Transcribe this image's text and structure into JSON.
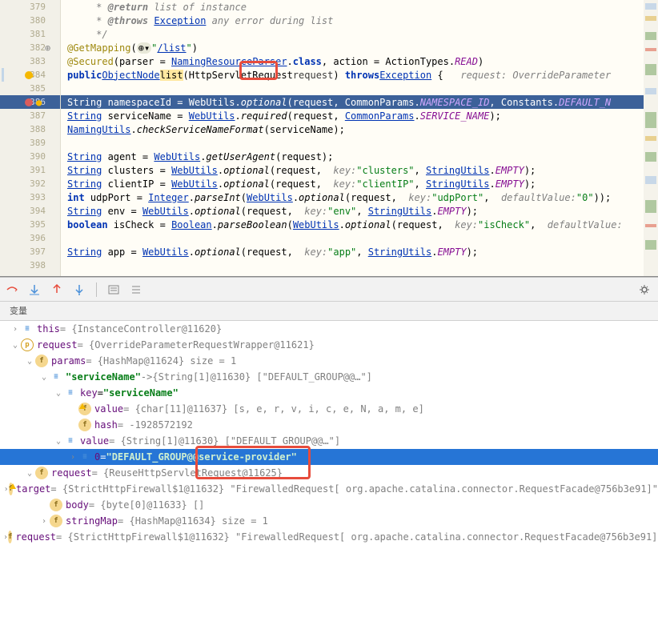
{
  "editor": {
    "lines": [
      {
        "num": 379,
        "kind": "doc",
        "content": "     * @return list of instance"
      },
      {
        "num": 380,
        "kind": "doc",
        "content": "     * @throws Exception any error during list"
      },
      {
        "num": 381,
        "kind": "doc",
        "content": "     */"
      },
      {
        "num": 382,
        "kind": "code",
        "content": "    @GetMapping(\"/list\")",
        "annotation": true,
        "gutter": "impl"
      },
      {
        "num": 383,
        "kind": "code",
        "content": "    @Secured(parser = NamingResourceParser.class, action = ActionTypes.READ)"
      },
      {
        "num": 384,
        "kind": "code",
        "content": "    public ObjectNode list(HttpServletRequest request) throws Exception {   request: OverrideParameter",
        "gutter": "breakpoint-warn"
      },
      {
        "num": 385,
        "kind": "blank",
        "content": ""
      },
      {
        "num": 386,
        "kind": "hl",
        "content": "        String namespaceId = WebUtils.optional(request, CommonParams.NAMESPACE_ID, Constants.DEFAULT_N",
        "gutter": "breakpoint"
      },
      {
        "num": 387,
        "kind": "code",
        "content": "        String serviceName = WebUtils.required(request, CommonParams.SERVICE_NAME);"
      },
      {
        "num": 388,
        "kind": "code",
        "content": "        NamingUtils.checkServiceNameFormat(serviceName);"
      },
      {
        "num": 389,
        "kind": "blank",
        "content": ""
      },
      {
        "num": 390,
        "kind": "code",
        "content": "        String agent = WebUtils.getUserAgent(request);"
      },
      {
        "num": 391,
        "kind": "code",
        "content": "        String clusters = WebUtils.optional(request,  key: \"clusters\", StringUtils.EMPTY);"
      },
      {
        "num": 392,
        "kind": "code",
        "content": "        String clientIP = WebUtils.optional(request,  key: \"clientIP\", StringUtils.EMPTY);"
      },
      {
        "num": 393,
        "kind": "code",
        "content": "        int udpPort = Integer.parseInt(WebUtils.optional(request,  key: \"udpPort\",  defaultValue: \"0\"));"
      },
      {
        "num": 394,
        "kind": "code",
        "content": "        String env = WebUtils.optional(request,  key: \"env\", StringUtils.EMPTY);"
      },
      {
        "num": 395,
        "kind": "code",
        "content": "        boolean isCheck = Boolean.parseBoolean(WebUtils.optional(request,  key: \"isCheck\",  defaultValue:"
      },
      {
        "num": 396,
        "kind": "blank",
        "content": ""
      },
      {
        "num": 397,
        "kind": "code",
        "content": "        String app = WebUtils.optional(request,  key: \"app\", StringUtils.EMPTY);"
      },
      {
        "num": 398,
        "kind": "blank",
        "content": ""
      }
    ],
    "highlighted_method": "list",
    "annotation_list_url": "/list"
  },
  "toolbar": {
    "tab_label": "变量"
  },
  "vars": {
    "rows": [
      {
        "depth": 0,
        "twisty": ">",
        "icon": "bars",
        "name": "this",
        "val": " = {InstanceController@11620}"
      },
      {
        "depth": 0,
        "twisty": "v",
        "icon": "p",
        "name": "request",
        "val": " = {OverrideParameterRequestWrapper@11621}"
      },
      {
        "depth": 1,
        "twisty": "v",
        "icon": "f",
        "name": "params",
        "val": " = {HashMap@11624}  size = 1"
      },
      {
        "depth": 2,
        "twisty": "v",
        "icon": "bars",
        "name": "\"serviceName\"",
        "nameStr": true,
        "arrow": " -> ",
        "val2": "{String[1]@11630} [\"DEFAULT_GROUP@@…\"]"
      },
      {
        "depth": 3,
        "twisty": "v",
        "icon": "bars",
        "name": "key",
        "eq": " = ",
        "valStr": "\"serviceName\""
      },
      {
        "depth": 4,
        "twisty": "",
        "icon": "f-warn",
        "name": "value",
        "val": " = {char[11]@11637} [s, e, r, v, i, c, e, N, a, m, e]"
      },
      {
        "depth": 4,
        "twisty": "",
        "icon": "f",
        "name": "hash",
        "val": " = -1928572192"
      },
      {
        "depth": 3,
        "twisty": "v",
        "icon": "bars",
        "name": "value",
        "val": " = {String[1]@11630} [\"DEFAULT_GROUP@@…\"]"
      },
      {
        "depth": 4,
        "twisty": ">",
        "icon": "arr",
        "name": "0",
        "eq": " = ",
        "valStr": "\"DEFAULT_GROUP@@service-provider\"",
        "selected": true
      },
      {
        "depth": 1,
        "twisty": "v",
        "icon": "f",
        "name": "request",
        "val": " = {ReuseHttpServletRequest@11625}"
      },
      {
        "depth": 2,
        "twisty": ">",
        "icon": "f-warn",
        "name": "target",
        "val": " = {StrictHttpFirewall$1@11632} \"FirewalledRequest[ org.apache.catalina.connector.RequestFacade@756b3e91]\""
      },
      {
        "depth": 2,
        "twisty": "",
        "icon": "f",
        "name": "body",
        "val": " = {byte[0]@11633} []"
      },
      {
        "depth": 2,
        "twisty": ">",
        "icon": "f",
        "name": "stringMap",
        "val": " = {HashMap@11634}  size = 1"
      },
      {
        "depth": 2,
        "twisty": ">",
        "icon": "f",
        "name": "request",
        "val": " = {StrictHttpFirewall$1@11632} \"FirewalledRequest[ org.apache.catalina.connector.RequestFacade@756b3e91]\""
      }
    ]
  }
}
